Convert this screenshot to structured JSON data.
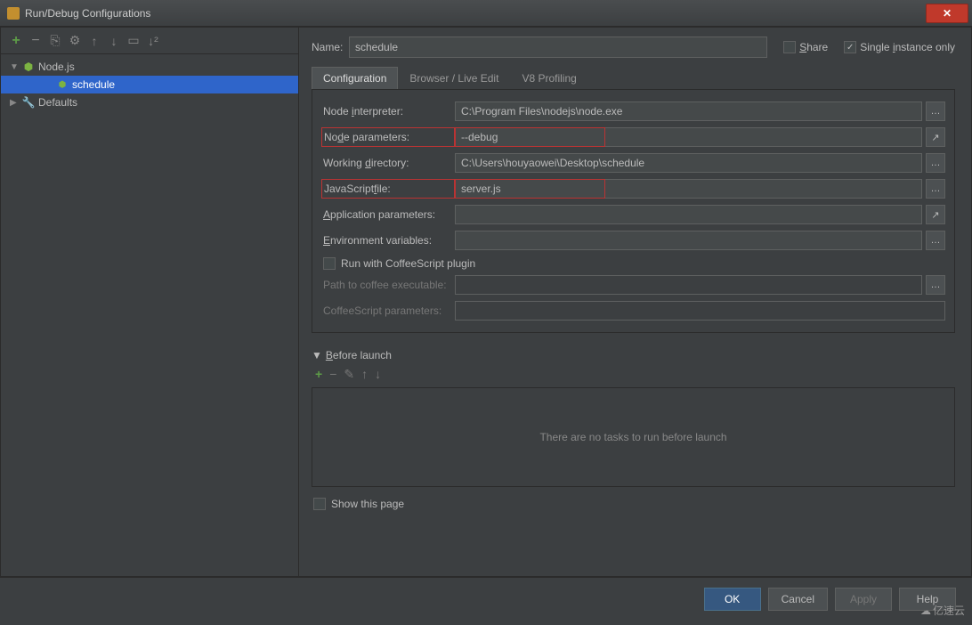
{
  "window": {
    "title": "Run/Debug Configurations"
  },
  "tree": {
    "nodejs_label": "Node.js",
    "schedule_label": "schedule",
    "defaults_label": "Defaults"
  },
  "name_row": {
    "label": "Name:",
    "value": "schedule",
    "share_label": "Share",
    "single_instance_label": "Single instance only",
    "single_instance_checked": true
  },
  "tabs": {
    "configuration": "Configuration",
    "browser": "Browser / Live Edit",
    "v8": "V8 Profiling"
  },
  "fields": {
    "node_interpreter": {
      "label": "Node interpreter:",
      "value": "C:\\Program Files\\nodejs\\node.exe"
    },
    "node_parameters": {
      "label": "Node parameters:",
      "value": "--debug"
    },
    "working_directory": {
      "label": "Working directory:",
      "value": "C:\\Users\\houyaowei\\Desktop\\schedule"
    },
    "javascript_file": {
      "label": "JavaScript file:",
      "value": "server.js"
    },
    "application_parameters": {
      "label": "Application parameters:",
      "value": ""
    },
    "environment_variables": {
      "label": "Environment variables:",
      "value": ""
    },
    "run_coffeescript": {
      "label": "Run with CoffeeScript plugin"
    },
    "coffee_executable": {
      "label": "Path to coffee executable:",
      "value": ""
    },
    "coffeescript_parameters": {
      "label": "CoffeeScript parameters:",
      "value": ""
    }
  },
  "before_launch": {
    "label": "Before launch",
    "empty_text": "There are no tasks to run before launch"
  },
  "show_this_page": "Show this page",
  "buttons": {
    "ok": "OK",
    "cancel": "Cancel",
    "apply": "Apply",
    "help": "Help"
  },
  "watermark": "亿速云"
}
